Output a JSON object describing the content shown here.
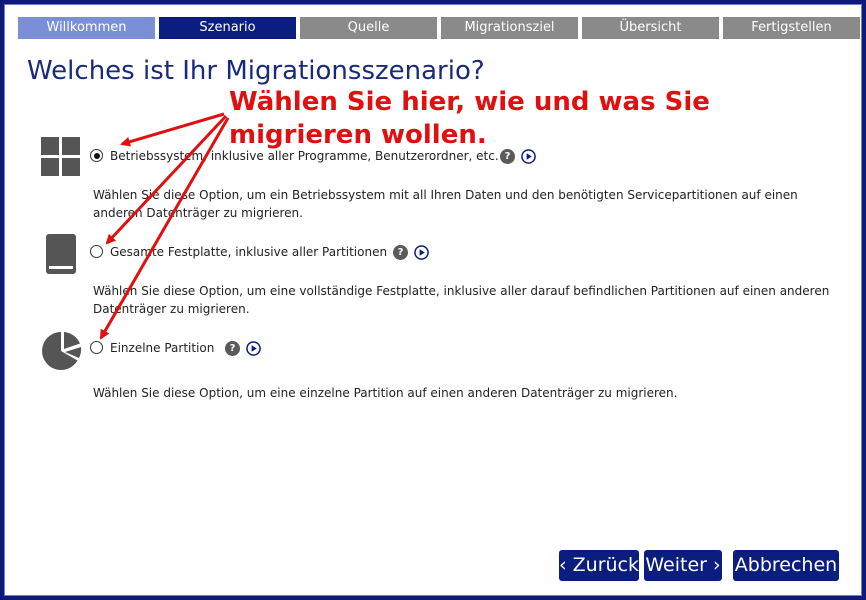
{
  "wizard_steps": [
    {
      "label": "Willkommen",
      "state": "past"
    },
    {
      "label": "Szenario",
      "state": "active"
    },
    {
      "label": "Quelle",
      "state": "future"
    },
    {
      "label": "Migrationsziel",
      "state": "future"
    },
    {
      "label": "Übersicht",
      "state": "future"
    },
    {
      "label": "Fertigstellen",
      "state": "future"
    }
  ],
  "title": "Welches ist Ihr Migrationsszenario?",
  "annotation": "Wählen Sie hier, wie und was Sie migrieren wollen.",
  "options": [
    {
      "icon": "windows-logo-icon",
      "label": "Betriebssystem, inklusive aller Programme, Benutzerordner, etc.",
      "description": "Wählen Sie diese Option, um ein Betriebssystem mit all Ihren Daten und den benötigten Servicepartitionen auf einen anderen Datenträger zu migrieren.",
      "selected": true
    },
    {
      "icon": "hard-disk-icon",
      "label": "Gesamte Festplatte, inklusive aller Partitionen",
      "description": "Wählen Sie diese Option, um eine vollständige Festplatte, inklusive aller darauf befindlichen Partitionen auf einen anderen Datenträger zu migrieren.",
      "selected": false
    },
    {
      "icon": "partition-pie-icon",
      "label": "Einzelne Partition",
      "description": "Wählen Sie diese Option, um eine einzelne Partition auf einen anderen Datenträger zu migrieren.",
      "selected": false
    }
  ],
  "help_glyph": "?",
  "buttons": {
    "back": "‹ Zurück",
    "next": "Weiter ›",
    "cancel": "Abbrechen"
  },
  "colors": {
    "frame": "#0d1a7a",
    "step_active": "#0b1d7e",
    "step_past": "#7a8fd6",
    "step_future": "#8a8a8a",
    "annotation": "#e01010",
    "button": "#0b1d7e"
  }
}
